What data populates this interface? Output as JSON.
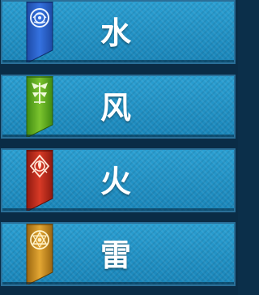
{
  "element_list": {
    "items": [
      {
        "label": "水",
        "icon": "water-emblem-icon",
        "banner_color": "#2b5fc8",
        "emblem_color": "#e8f2ff"
      },
      {
        "label": "风",
        "icon": "wind-emblem-icon",
        "banner_color": "#5faa22",
        "emblem_color": "#eef9d8"
      },
      {
        "label": "火",
        "icon": "fire-emblem-icon",
        "banner_color": "#c32d1c",
        "emblem_color": "#ffe6d6"
      },
      {
        "label": "雷",
        "icon": "thunder-emblem-icon",
        "banner_color": "#d08d1c",
        "emblem_color": "#fff2c8"
      }
    ]
  }
}
